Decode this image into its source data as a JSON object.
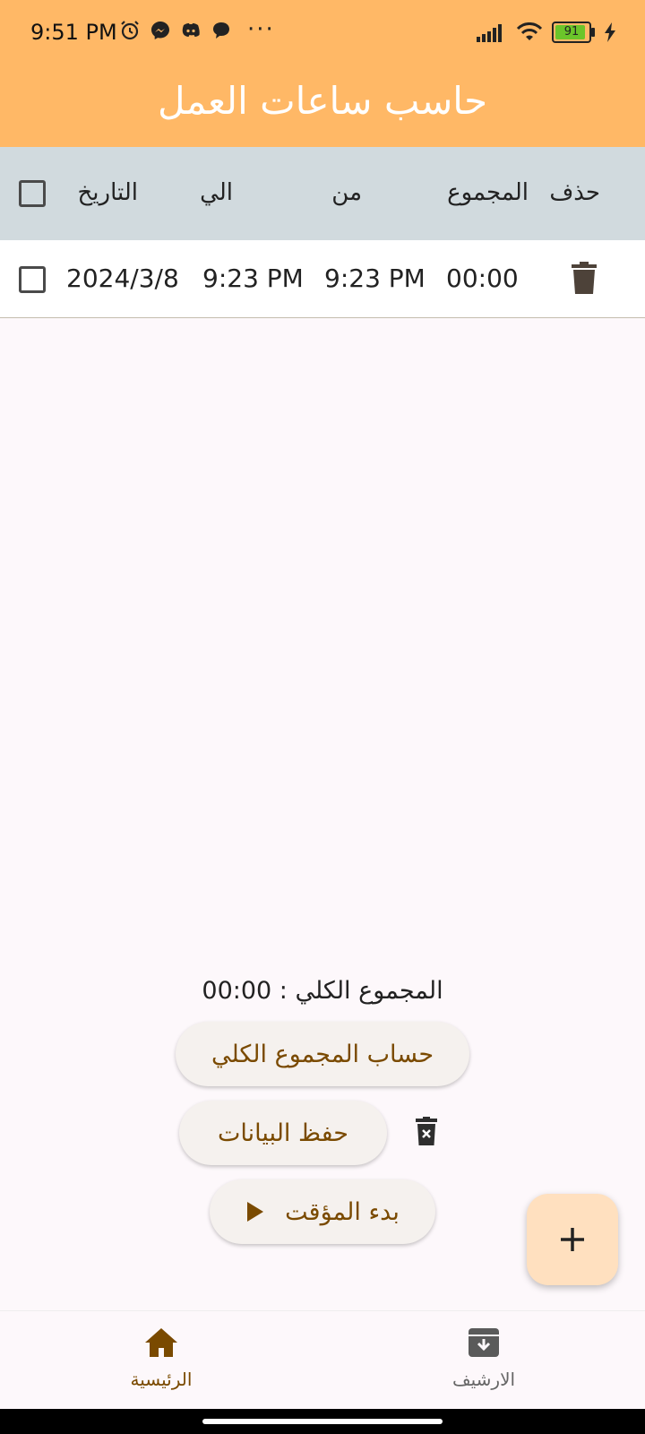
{
  "status_bar": {
    "time": "9:51 PM",
    "left_icons": [
      "alarm-icon",
      "messenger-icon",
      "discord-icon",
      "chat-bubble-icon"
    ],
    "overflow": "···",
    "battery": "91",
    "right_icons": [
      "signal-icon",
      "wifi-icon",
      "battery-icon",
      "charging-icon"
    ]
  },
  "app_bar": {
    "title": "حاسب ساعات العمل"
  },
  "table": {
    "headers": {
      "delete": "حذف",
      "total": "المجموع",
      "from": "من",
      "to": "الي",
      "date": "التاريخ"
    },
    "rows": [
      {
        "date": "2024/3/8",
        "time_a": "9:23 PM",
        "time_b": "9:23 PM",
        "total": "00:00"
      }
    ]
  },
  "summary": {
    "total_label": "المجموع الكلي : 00:00",
    "calc_button": "حساب المجموع الكلي",
    "save_button": "حفظ البيانات",
    "timer_button": "بدء المؤقت"
  },
  "fab": {
    "icon": "plus-icon"
  },
  "bottom_nav": {
    "items": [
      {
        "label": "الرئيسية",
        "icon": "home-icon",
        "active": true
      },
      {
        "label": "الارشيف",
        "icon": "archive-icon",
        "active": false
      }
    ]
  },
  "colors": {
    "app_bar": "#ffb866",
    "header": "#d1dade",
    "accent_text": "#7a4a00",
    "fab": "#ffe0bf"
  }
}
